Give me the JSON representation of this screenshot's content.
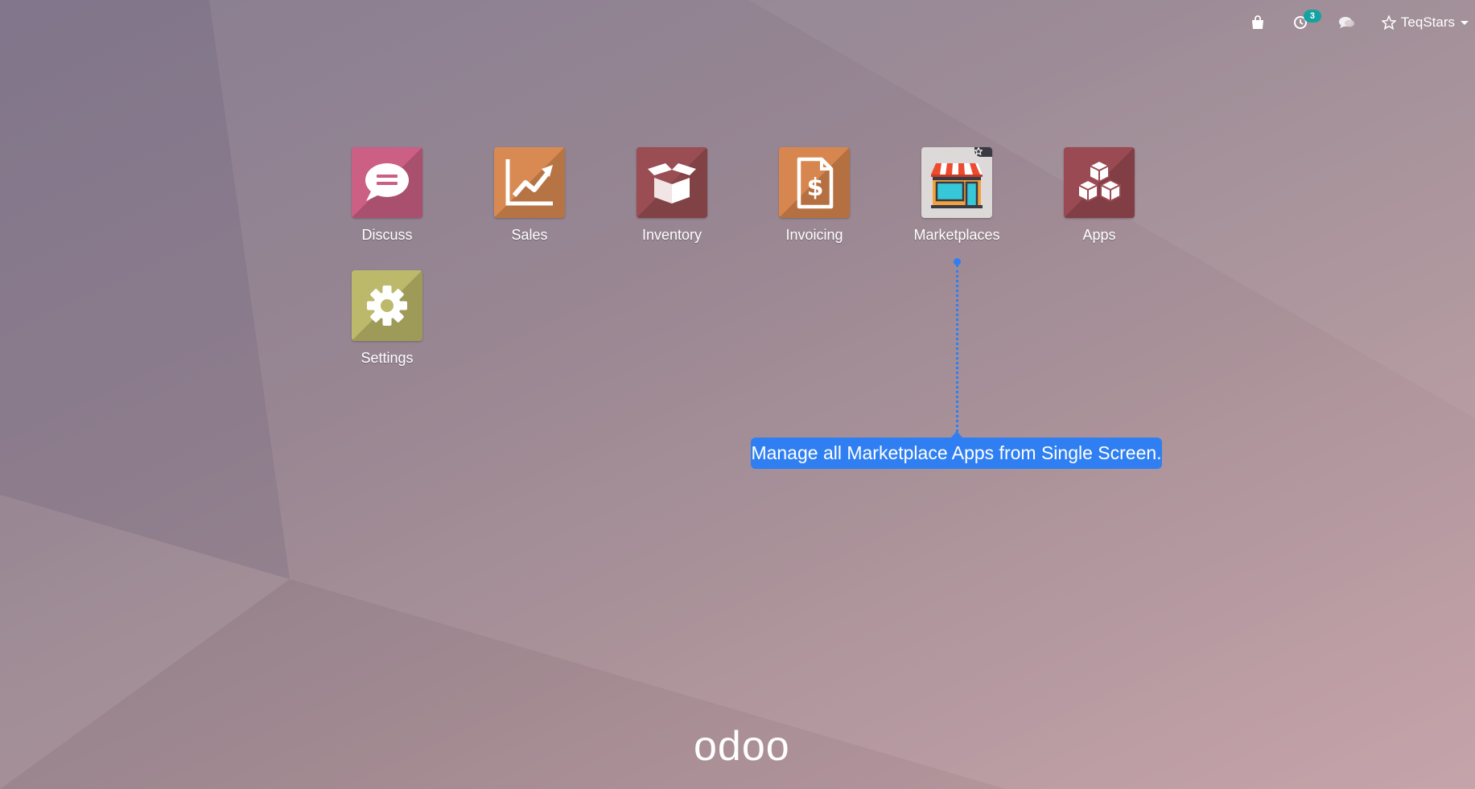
{
  "systray": {
    "activity_count": "3",
    "user_name": "TeqStars",
    "icons": [
      "shopping-bag-icon",
      "activity-clock-icon",
      "chat-bubbles-icon",
      "star-icon",
      "caret-down-icon"
    ]
  },
  "apps": [
    {
      "label": "Discuss",
      "icon": "speech-bubble-icon",
      "color": "#cb5f84"
    },
    {
      "label": "Sales",
      "icon": "trend-chart-icon",
      "color": "#d98a52"
    },
    {
      "label": "Inventory",
      "icon": "open-box-icon",
      "color": "#9a4e53"
    },
    {
      "label": "Invoicing",
      "icon": "dollar-document-icon",
      "color": "#d8864f"
    },
    {
      "label": "Marketplaces",
      "icon": "storefront-icon",
      "color": "#dcd9d8"
    },
    {
      "label": "Apps",
      "icon": "cubes-icon",
      "color": "#9a4a52"
    },
    {
      "label": "Settings",
      "icon": "gear-icon",
      "color": "#bcb96a"
    }
  ],
  "tooltip": {
    "text": "Manage all Marketplace Apps from Single Screen.",
    "color": "#2f7ff2"
  },
  "logo": {
    "text": "odoo"
  }
}
